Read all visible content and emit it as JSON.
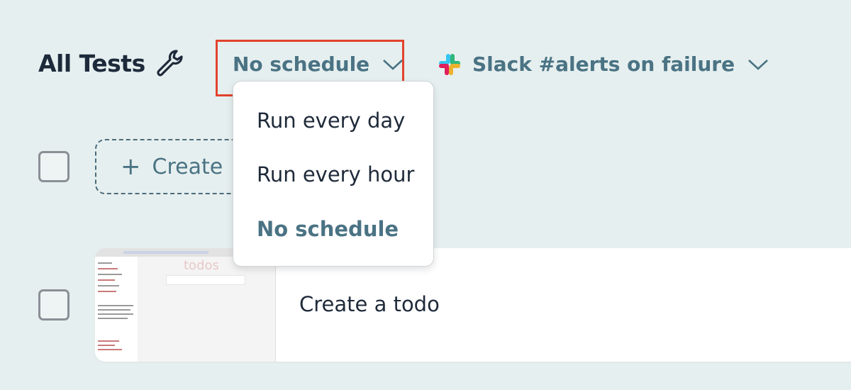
{
  "header": {
    "title": "All Tests",
    "title_icon": "wrench-icon",
    "schedule_label": "No schedule",
    "notify_label": "Slack #alerts on failure"
  },
  "schedule_menu": {
    "options": [
      "Run every day",
      "Run every hour",
      "No schedule"
    ],
    "selected": "No schedule"
  },
  "create_button": {
    "label": "Create"
  },
  "tests": [
    {
      "name": "Create a todo",
      "thumbnail_text": "todos"
    }
  ],
  "colors": {
    "accent": "#4a7384",
    "highlight": "#e2422c",
    "background": "#e6efef"
  }
}
